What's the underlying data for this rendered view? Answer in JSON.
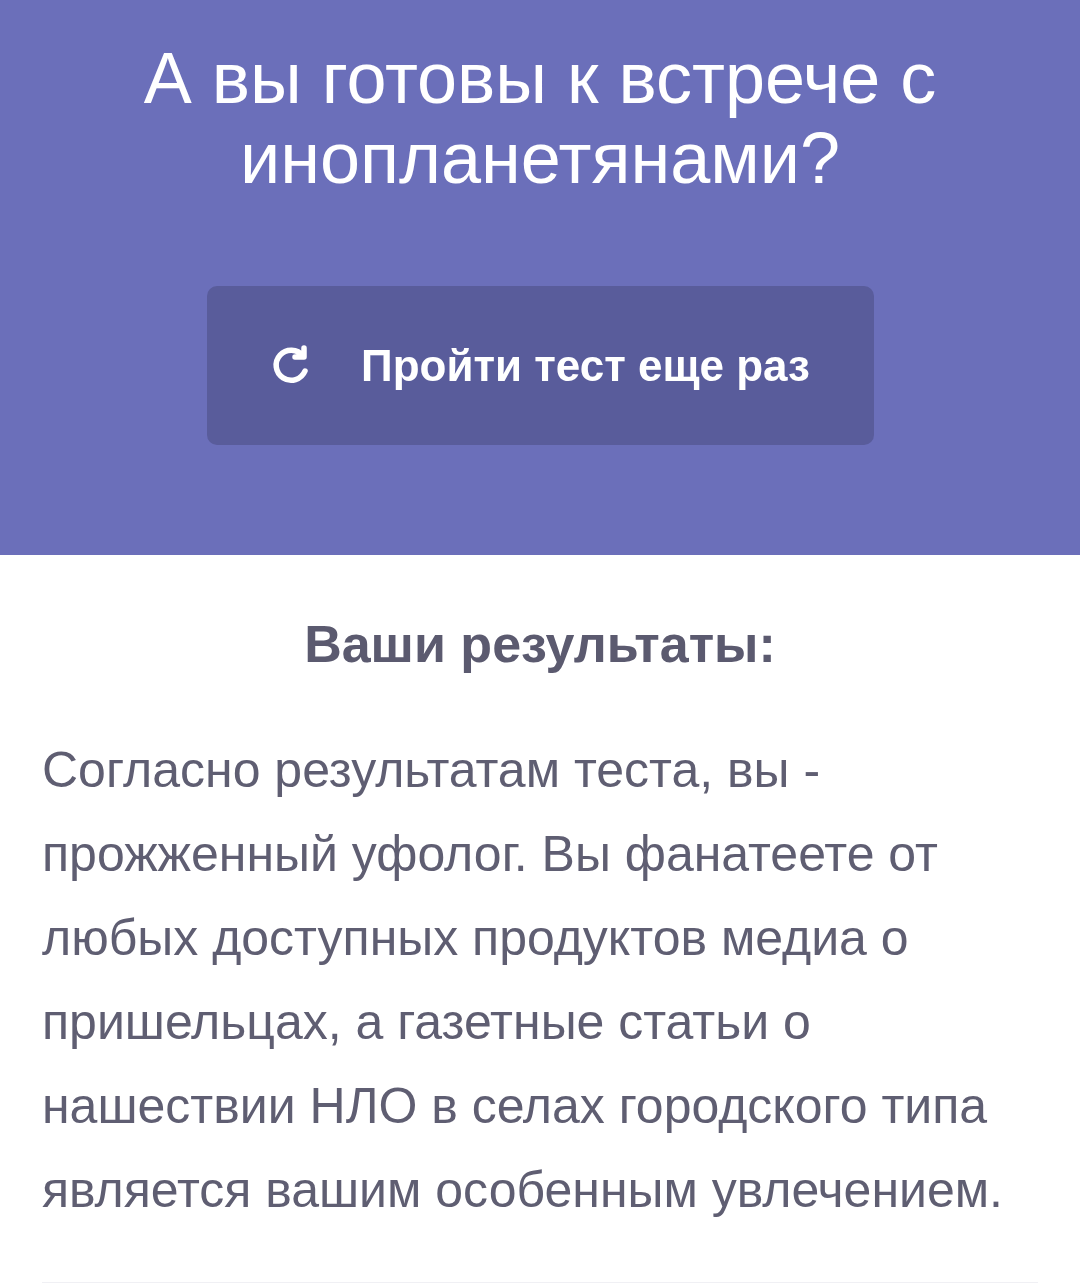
{
  "header": {
    "title": "А вы готовы к встрече с инопланетянами?",
    "button": {
      "label": "Пройти тест еще раз"
    }
  },
  "results": {
    "heading": "Ваши результаты:",
    "text": "Согласно результатам теста, вы - прожженный уфолог. Вы фанатеете от любых доступных продуктов медиа о пришельцах, а газетные статьи о нашествии НЛО в селах городского типа является вашим особенным увлечением."
  }
}
